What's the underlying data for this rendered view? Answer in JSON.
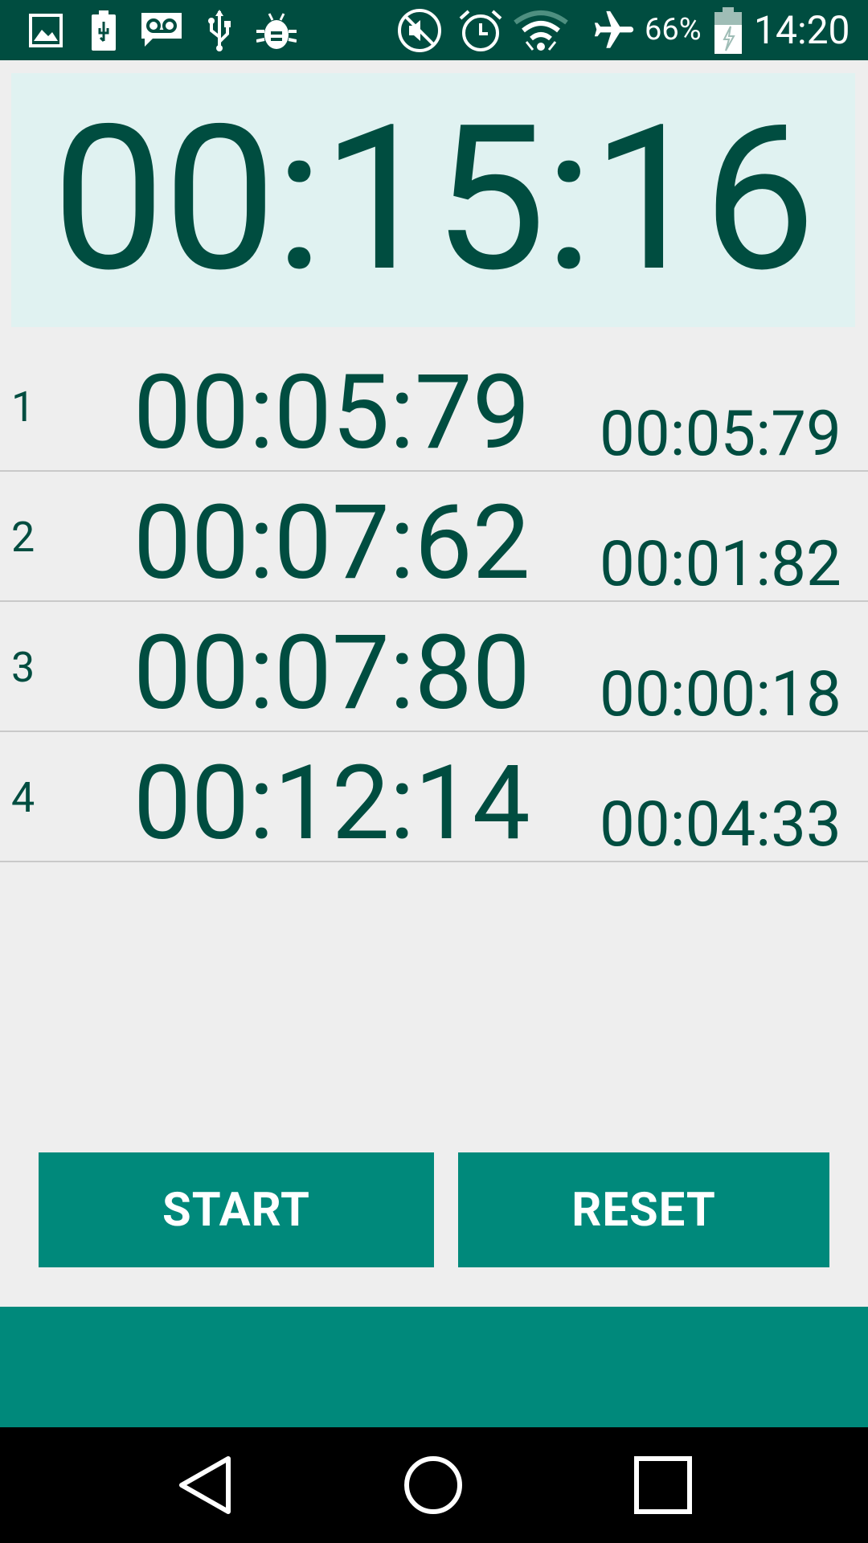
{
  "status_bar": {
    "battery_percent": "66%",
    "time": "14:20",
    "left_icons": [
      "image-icon",
      "battery-usb-icon",
      "voicemail-icon",
      "usb-icon",
      "bug-icon"
    ],
    "right_icons": [
      "mute-icon",
      "alarm-icon",
      "wifi-icon",
      "airplane-icon",
      "battery-icon"
    ]
  },
  "timer": {
    "display": "00:15:16"
  },
  "laps": [
    {
      "number": "1",
      "total": "00:05:79",
      "split": "00:05:79"
    },
    {
      "number": "2",
      "total": "00:07:62",
      "split": "00:01:82"
    },
    {
      "number": "3",
      "total": "00:07:80",
      "split": "00:00:18"
    },
    {
      "number": "4",
      "total": "00:12:14",
      "split": "00:04:33"
    }
  ],
  "controls": {
    "start_label": "START",
    "reset_label": "RESET"
  },
  "colors": {
    "status_bar": "#004d40",
    "accent": "#00897b",
    "timer_bg": "#e0f2f1",
    "text": "#004d40"
  },
  "navigation": [
    "back-icon",
    "home-icon",
    "recents-icon"
  ]
}
